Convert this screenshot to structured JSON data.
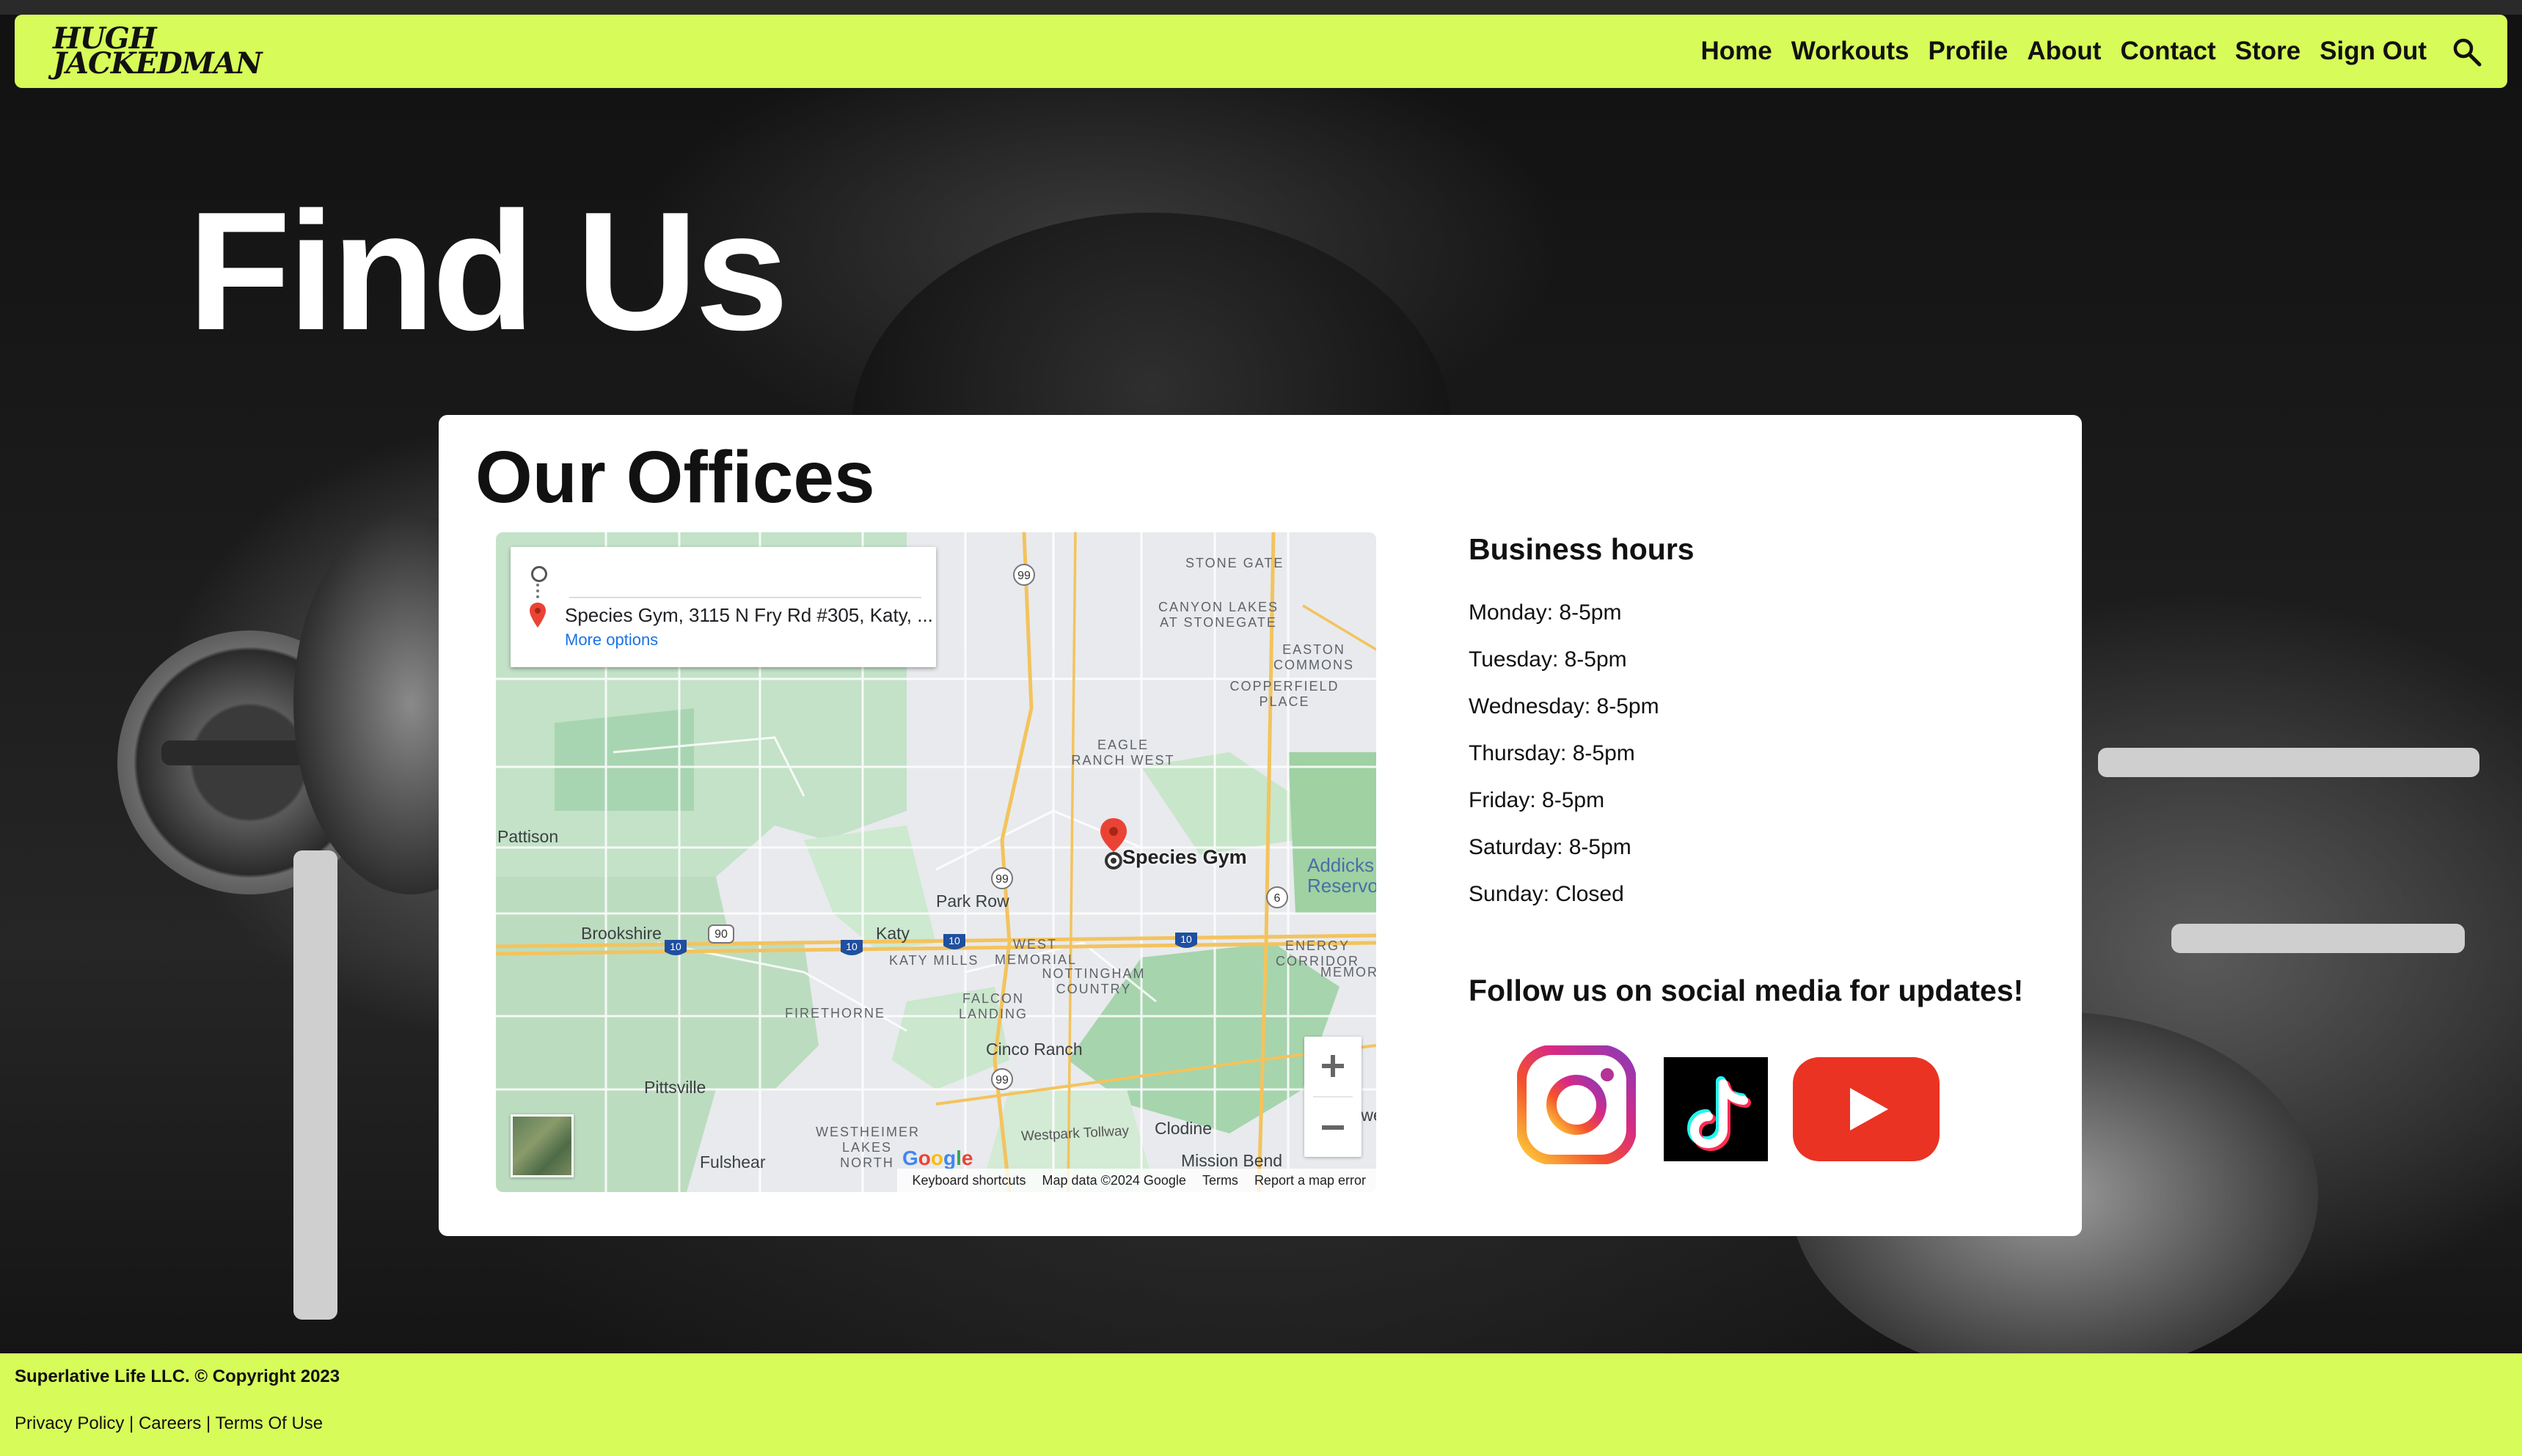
{
  "brand": {
    "logo_line1": "HUGH",
    "logo_line2": "JACKEDMAN",
    "accent": "#d7fb59"
  },
  "nav": {
    "items": [
      {
        "label": "Home"
      },
      {
        "label": "Workouts"
      },
      {
        "label": "Profile"
      },
      {
        "label": "About"
      },
      {
        "label": "Contact"
      },
      {
        "label": "Store"
      },
      {
        "label": "Sign Out"
      }
    ],
    "search_icon": "search-icon"
  },
  "page": {
    "title": "Find Us"
  },
  "offices": {
    "title": "Our Offices",
    "map": {
      "directions_address": "Species Gym, 3115 N Fry Rd #305, Katy, ...",
      "more_options": "More options",
      "pin_label": "Species Gym",
      "places": {
        "stone_gate": "STONE GATE",
        "canyon_lakes": "CANYON LAKES AT STONEGATE",
        "easton_commons": "EASTON COMMONS",
        "copperfield": "COPPERFIELD PLACE",
        "eagle_ranch": "EAGLE RANCH WEST",
        "pattison": "Pattison",
        "addicks": "Addicks Reservoi",
        "park_row": "Park Row",
        "brookshire": "Brookshire",
        "katy": "Katy",
        "katy_mills": "KATY MILLS",
        "west_memorial": "WEST MEMORIAL",
        "nottingham": "NOTTINGHAM COUNTRY",
        "energy_corridor": "ENERGY CORRIDOR",
        "memor": "MEMOR",
        "firethorne": "FIRETHORNE",
        "falcon_landing": "FALCON LANDING",
        "cinco_ranch": "Cinco Ranch",
        "pittsville": "Pittsville",
        "westheimer": "WESTHEIMER LAKES NORTH",
        "fulshear": "Fulshear",
        "westpark": "Westpark Tollway",
        "clodine": "Clodine",
        "mission_bend": "Mission Bend",
        "howe": "Howe"
      },
      "shields": [
        "99",
        "90",
        "10",
        "10",
        "10",
        "10",
        "6",
        "99",
        "99"
      ],
      "google": "Google",
      "attribution": {
        "shortcuts": "Keyboard shortcuts",
        "map_data": "Map data ©2024 Google",
        "terms": "Terms",
        "report": "Report a map error"
      }
    },
    "hours_title": "Business hours",
    "hours": [
      "Monday: 8-5pm",
      "Tuesday: 8-5pm",
      "Wednesday: 8-5pm",
      "Thursday: 8-5pm",
      "Friday: 8-5pm",
      "Saturday: 8-5pm",
      "Sunday: Closed"
    ],
    "social_title": "Follow us on social media for updates!",
    "social_icons": [
      "instagram-icon",
      "tiktok-icon",
      "youtube-icon"
    ]
  },
  "footer": {
    "copyright": "Superlative Life LLC. © Copyright 2023",
    "links": [
      "Privacy Policy",
      "Careers",
      "Terms Of Use"
    ],
    "separator": " | "
  }
}
